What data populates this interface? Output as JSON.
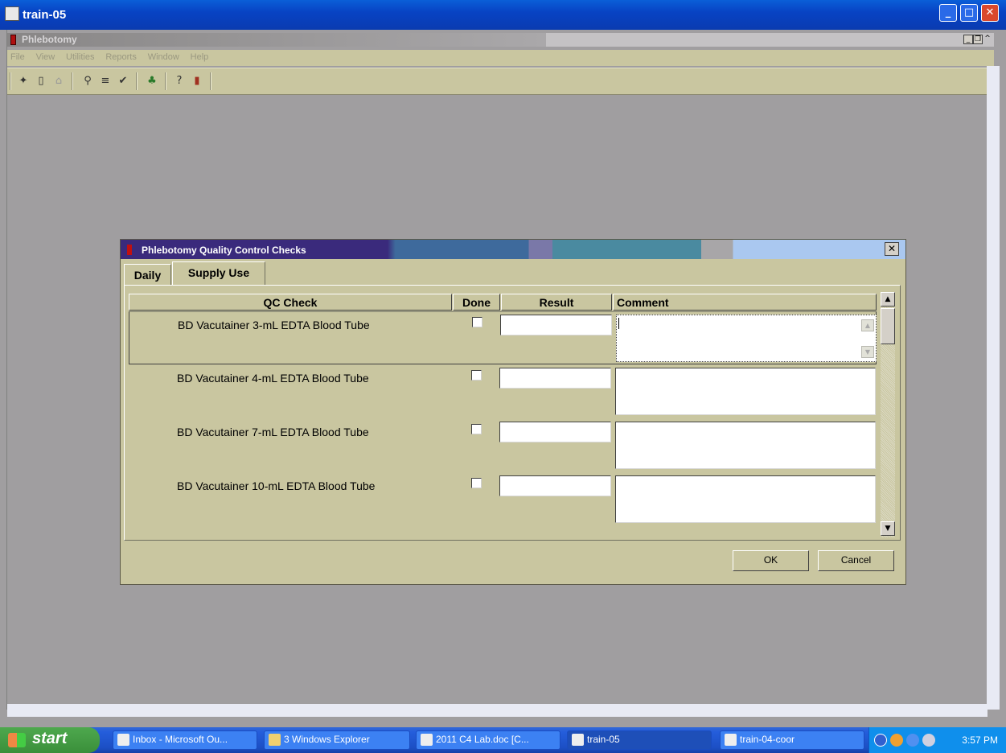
{
  "outer_window": {
    "title": "train-05"
  },
  "app": {
    "title": "Phlebotomy",
    "menu": [
      "File",
      "View",
      "Utilities",
      "Reports",
      "Window",
      "Help"
    ],
    "toolbar_icons": [
      "new-icon",
      "clipboard-icon",
      "chart-icon",
      "wand-icon",
      "list-icon",
      "check-icon",
      "people-icon",
      "help-icon",
      "exit-icon"
    ]
  },
  "dialog": {
    "title": "Phlebotomy Quality Control Checks",
    "tabs": [
      {
        "label": "Daily",
        "active": false
      },
      {
        "label": "Supply Use",
        "active": true
      }
    ],
    "columns": {
      "qc_check": "QC Check",
      "done": "Done",
      "result": "Result",
      "comment": "Comment"
    },
    "rows": [
      {
        "qc_check": "BD Vacutainer 3-mL EDTA Blood Tube",
        "done": false,
        "result": "",
        "comment": ""
      },
      {
        "qc_check": "BD Vacutainer 4-mL EDTA Blood Tube",
        "done": false,
        "result": "",
        "comment": ""
      },
      {
        "qc_check": "BD Vacutainer 7-mL EDTA Blood Tube",
        "done": false,
        "result": "",
        "comment": ""
      },
      {
        "qc_check": "BD Vacutainer 10-mL EDTA Blood Tube",
        "done": false,
        "result": "",
        "comment": ""
      }
    ],
    "ok_label": "OK",
    "cancel_label": "Cancel"
  },
  "taskbar": {
    "start_label": "start",
    "tasks": [
      {
        "label": "Inbox - Microsoft Ou..."
      },
      {
        "label": "3 Windows Explorer"
      },
      {
        "label": "2011 C4 Lab.doc [C..."
      },
      {
        "label": "train-05"
      },
      {
        "label": "train-04-coor"
      }
    ],
    "clock": "3:57 PM"
  }
}
